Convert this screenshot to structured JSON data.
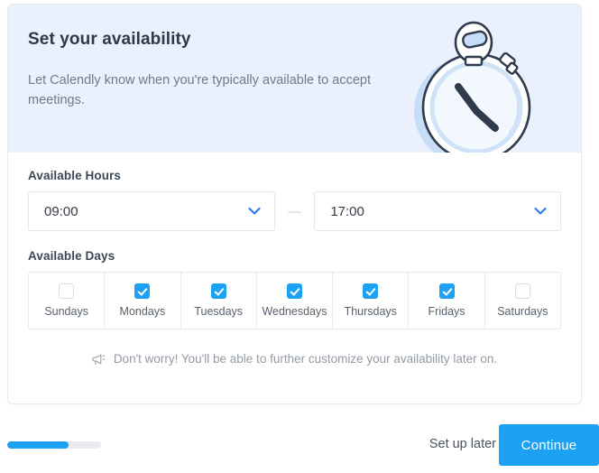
{
  "header": {
    "title": "Set your availability",
    "description": "Let Calendly know when you're typically available to accept meetings.",
    "background_color": "#eaf0fc",
    "illustration": "stopwatch-illustration"
  },
  "hours": {
    "label": "Available Hours",
    "start_value": "09:00",
    "end_value": "17:00",
    "separator": "—",
    "chevron_color": "#2f7df6"
  },
  "days": {
    "label": "Available Days",
    "items": [
      {
        "label": "Sundays",
        "checked": false
      },
      {
        "label": "Mondays",
        "checked": true
      },
      {
        "label": "Tuesdays",
        "checked": true
      },
      {
        "label": "Wednesdays",
        "checked": true
      },
      {
        "label": "Thursdays",
        "checked": true
      },
      {
        "label": "Fridays",
        "checked": true
      },
      {
        "label": "Saturdays",
        "checked": false
      }
    ],
    "checked_color": "#1da1f2"
  },
  "hint": {
    "icon": "megaphone-icon",
    "text": "Don't worry! You'll be able to further customize your availability later on."
  },
  "footer": {
    "progress_percent": 65,
    "progress_color": "#1da1f2",
    "setup_later_label": "Set up later",
    "continue_label": "Continue",
    "continue_color": "#1da1f2"
  }
}
